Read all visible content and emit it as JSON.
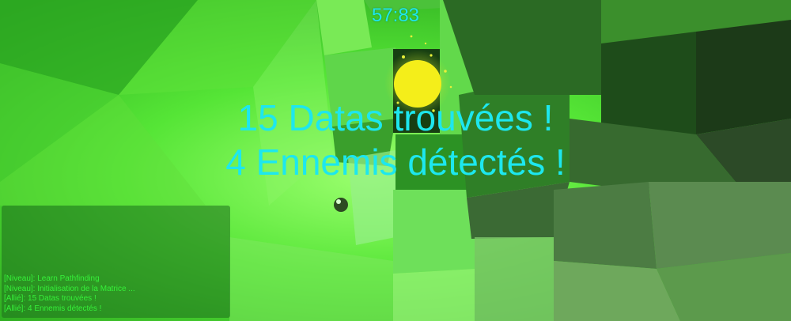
{
  "hud": {
    "timer": "57:83",
    "text_color": "#1de7ee",
    "messages": [
      "15 Datas trouvées !",
      "4 Ennemis détectés !"
    ]
  },
  "chat": {
    "text_color": "#36f03a",
    "lines": [
      "[Niveau]: Learn Pathfinding",
      "[Niveau]: Initialisation de la Matrice ...",
      "[Allié]: 15 Datas trouvées !",
      "[Allié]: 4 Ennemis détectés !"
    ]
  },
  "scene": {
    "background": "#3fd22a",
    "orb_color": "#f4ee1a"
  }
}
